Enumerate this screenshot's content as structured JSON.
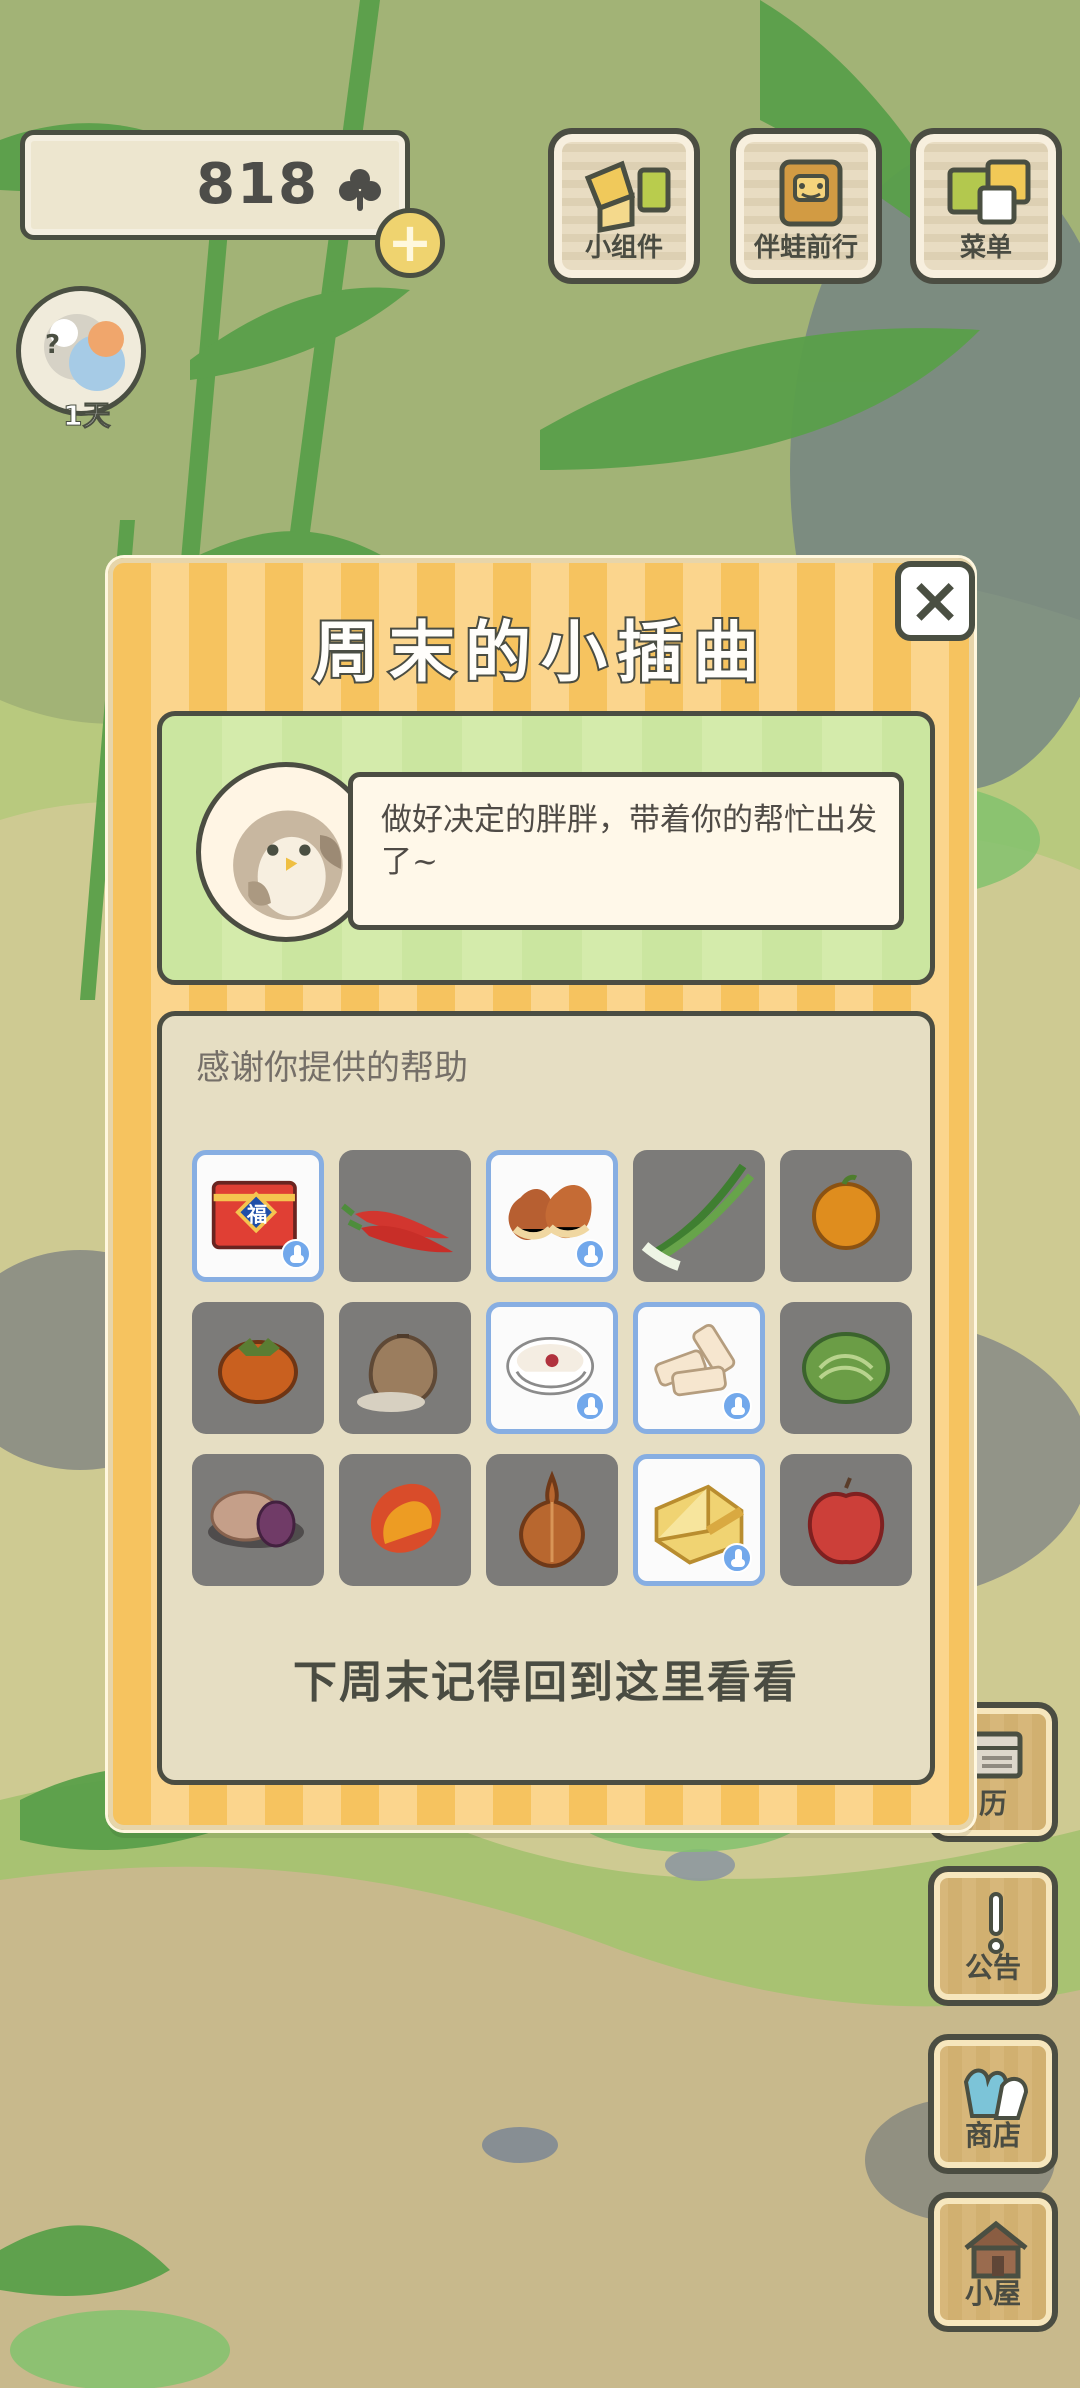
{
  "hud": {
    "currency_value": "818",
    "day_label": "1天"
  },
  "top_nav": [
    {
      "label": "小组件",
      "icon": "widget-icon"
    },
    {
      "label": "伴蛙前行",
      "icon": "frog-companion-icon"
    },
    {
      "label": "菜单",
      "icon": "menu-icon"
    }
  ],
  "side_nav": [
    {
      "label": "历",
      "icon": "calendar-icon"
    },
    {
      "label": "公告",
      "icon": "announcement-icon"
    },
    {
      "label": "商店",
      "icon": "shop-icon"
    },
    {
      "label": "小屋",
      "icon": "house-icon"
    }
  ],
  "modal": {
    "title": "周末的小插曲",
    "close_icon": "close-icon",
    "dialog_text": "做好决定的胖胖，带着你的帮忙出发了~",
    "thanks_title": "感谢你提供的帮助",
    "footer_text": "下周末记得回到这里看看",
    "items": [
      {
        "icon": "gift-box-icon",
        "selected": true
      },
      {
        "icon": "chili-pepper-icon",
        "selected": false
      },
      {
        "icon": "chestnut-icon",
        "selected": true
      },
      {
        "icon": "green-onion-icon",
        "selected": false
      },
      {
        "icon": "orange-icon",
        "selected": false
      },
      {
        "icon": "persimmon-icon",
        "selected": false
      },
      {
        "icon": "grain-sack-icon",
        "selected": false
      },
      {
        "icon": "porridge-bowl-icon",
        "selected": true
      },
      {
        "icon": "cake-bars-icon",
        "selected": true
      },
      {
        "icon": "cabbage-icon",
        "selected": false
      },
      {
        "icon": "pastry-icon",
        "selected": false
      },
      {
        "icon": "mango-icon",
        "selected": false
      },
      {
        "icon": "onion-icon",
        "selected": false
      },
      {
        "icon": "cheese-icon",
        "selected": true
      },
      {
        "icon": "apple-icon",
        "selected": false
      }
    ]
  },
  "colors": {
    "modal_orange": "#f6c35f",
    "modal_light_orange": "#fbd58d",
    "panel_green": "#cbe6a0",
    "panel_beige": "#e6dec3",
    "selection_blue": "#87aee2",
    "outline_dark": "#4a4f42"
  }
}
